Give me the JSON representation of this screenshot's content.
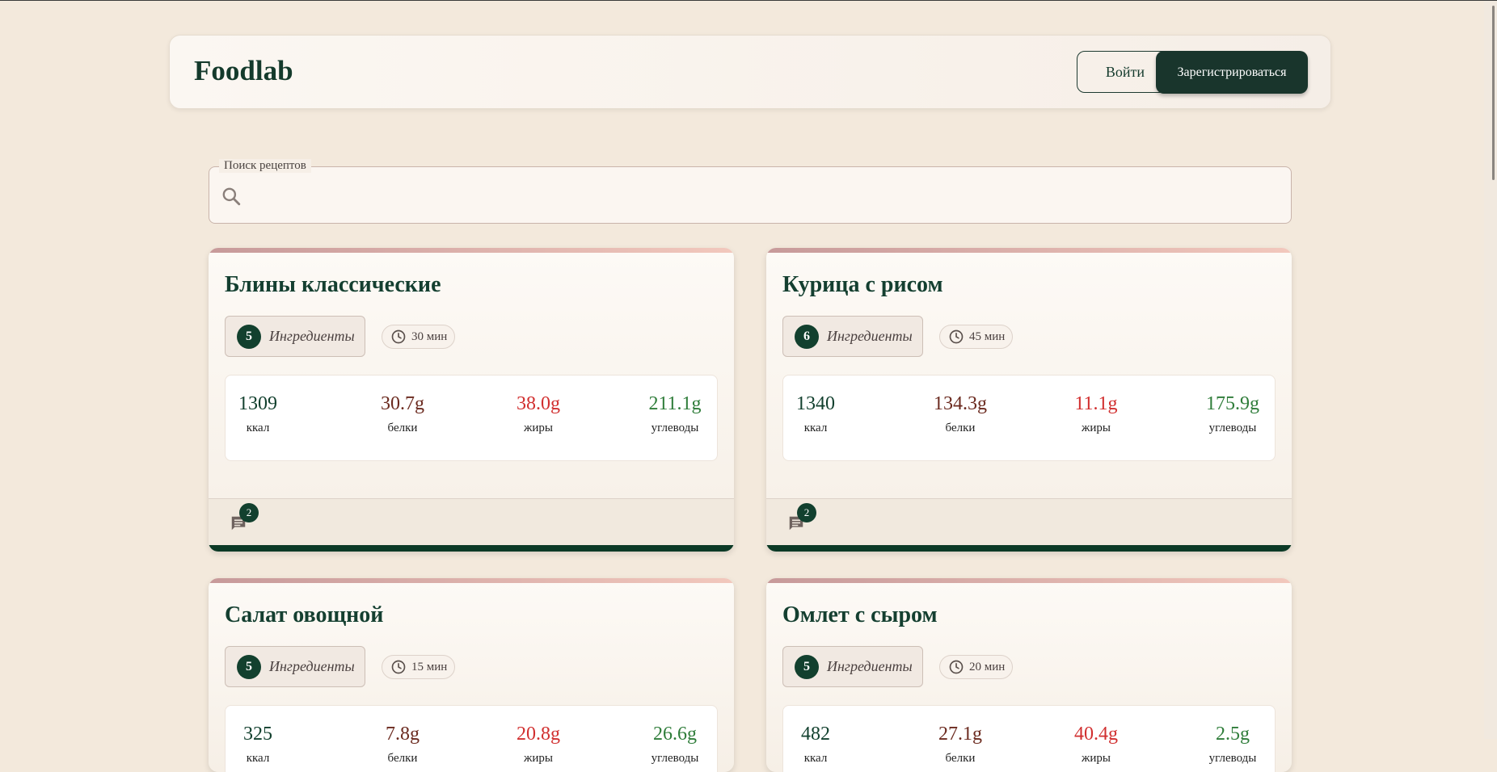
{
  "header": {
    "logo": "Foodlab",
    "login_label": "Войти",
    "register_label": "Зарегистрироваться"
  },
  "search": {
    "legend": "Поиск рецептов",
    "value": "",
    "placeholder": ""
  },
  "nutrition_labels": {
    "kcal": "ккал",
    "protein": "белки",
    "fat": "жиры",
    "carbs": "углеводы"
  },
  "colors": {
    "accent": "#12402e",
    "protein": "#6b2a1f",
    "fat": "#d12f2f",
    "carbs": "#2f7d3a"
  },
  "recipes": [
    {
      "title": "Блины классические",
      "ingredients_count": "5",
      "ingredients_label": "Ингредиенты",
      "time": "30 мин",
      "kcal": "1309",
      "protein": "30.7g",
      "fat": "38.0g",
      "carbs": "211.1g",
      "comments": "2"
    },
    {
      "title": "Курица с рисом",
      "ingredients_count": "6",
      "ingredients_label": "Ингредиенты",
      "time": "45 мин",
      "kcal": "1340",
      "protein": "134.3g",
      "fat": "11.1g",
      "carbs": "175.9g",
      "comments": "2"
    },
    {
      "title": "Салат овощной",
      "ingredients_count": "5",
      "ingredients_label": "Ингредиенты",
      "time": "15 мин",
      "kcal": "325",
      "protein": "7.8g",
      "fat": "20.8g",
      "carbs": "26.6g",
      "comments": ""
    },
    {
      "title": "Омлет с сыром",
      "ingredients_count": "5",
      "ingredients_label": "Ингредиенты",
      "time": "20 мин",
      "kcal": "482",
      "protein": "27.1g",
      "fat": "40.4g",
      "carbs": "2.5g",
      "comments": ""
    }
  ]
}
